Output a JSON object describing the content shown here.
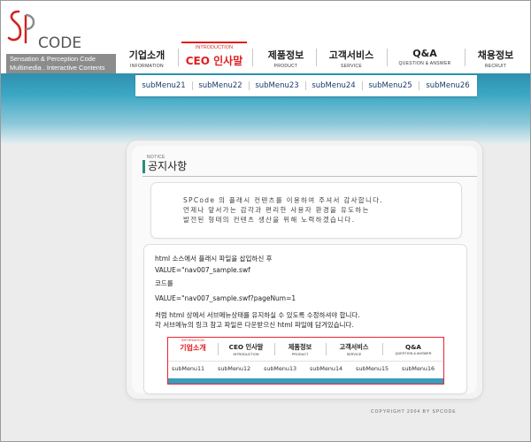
{
  "logo": {
    "brand": "CODE",
    "tagline_line1": "Sensation & Perception Code",
    "tagline_line2": "Multimedia . Interactive Contents"
  },
  "nav": [
    {
      "ko": "기업소개",
      "en": "INFORMATION"
    },
    {
      "ko": "CEO 인사말",
      "en": "INTRODUCTION",
      "active": true
    },
    {
      "ko": "제품정보",
      "en": "PRODUCT"
    },
    {
      "ko": "고객서비스",
      "en": "SERVICE"
    },
    {
      "ko": "Q&A",
      "en": "QUESTION & ANSWER"
    },
    {
      "ko": "채용정보",
      "en": "RECRUIT"
    }
  ],
  "submenu": [
    "subMenu21",
    "subMenu22",
    "subMenu23",
    "subMenu24",
    "subMenu25",
    "subMenu26"
  ],
  "notice": {
    "small": "NOTICE",
    "title": "공지사항"
  },
  "greeting": [
    "SPCode 의 플래시 컨텐츠를 이용하여 주셔서 감사합니다.",
    "언제나 앞서가는 감각과 편리한 사용자 환경을 유도하는",
    "발전된 형태의 컨텐츠 생산을 위해 노력하겠습니다."
  ],
  "info": {
    "line1": "html 소스에서 플래시 파일을 삽입하신 후",
    "line2": "VALUE=\"nav007_sample.swf",
    "line3": "코드를",
    "line4": "VALUE=\"nav007_sample.swf?pageNum=1",
    "line5": "처럼 html 상에서 서브메뉴상태를 유지하실 수 있도록 수정하셔야 합니다.",
    "line6": "각 서브메뉴의 링크 참고 파일은 다운받으신 html 파일에 담겨있습니다."
  },
  "mini_nav": [
    {
      "ko": "기업소개",
      "en": "",
      "tag": "INFORMATION",
      "active": true
    },
    {
      "ko": "CEO 인사말",
      "en": "INTRODUCTION"
    },
    {
      "ko": "제품정보",
      "en": "PRODUCT"
    },
    {
      "ko": "고객서비스",
      "en": "SERVICE"
    },
    {
      "ko": "Q&A",
      "en": "QUESTION & ANSWER"
    }
  ],
  "mini_submenu": [
    "subMenu11",
    "subMenu12",
    "subMenu13",
    "subMenu14",
    "subMenu15",
    "subMenu16"
  ],
  "copyright": "COPYRIGHT 2004 BY SPCODE",
  "colors": {
    "accent_red": "#e21d1d",
    "teal": "#3ba7c4",
    "notice_bar": "#2c8c7c"
  }
}
